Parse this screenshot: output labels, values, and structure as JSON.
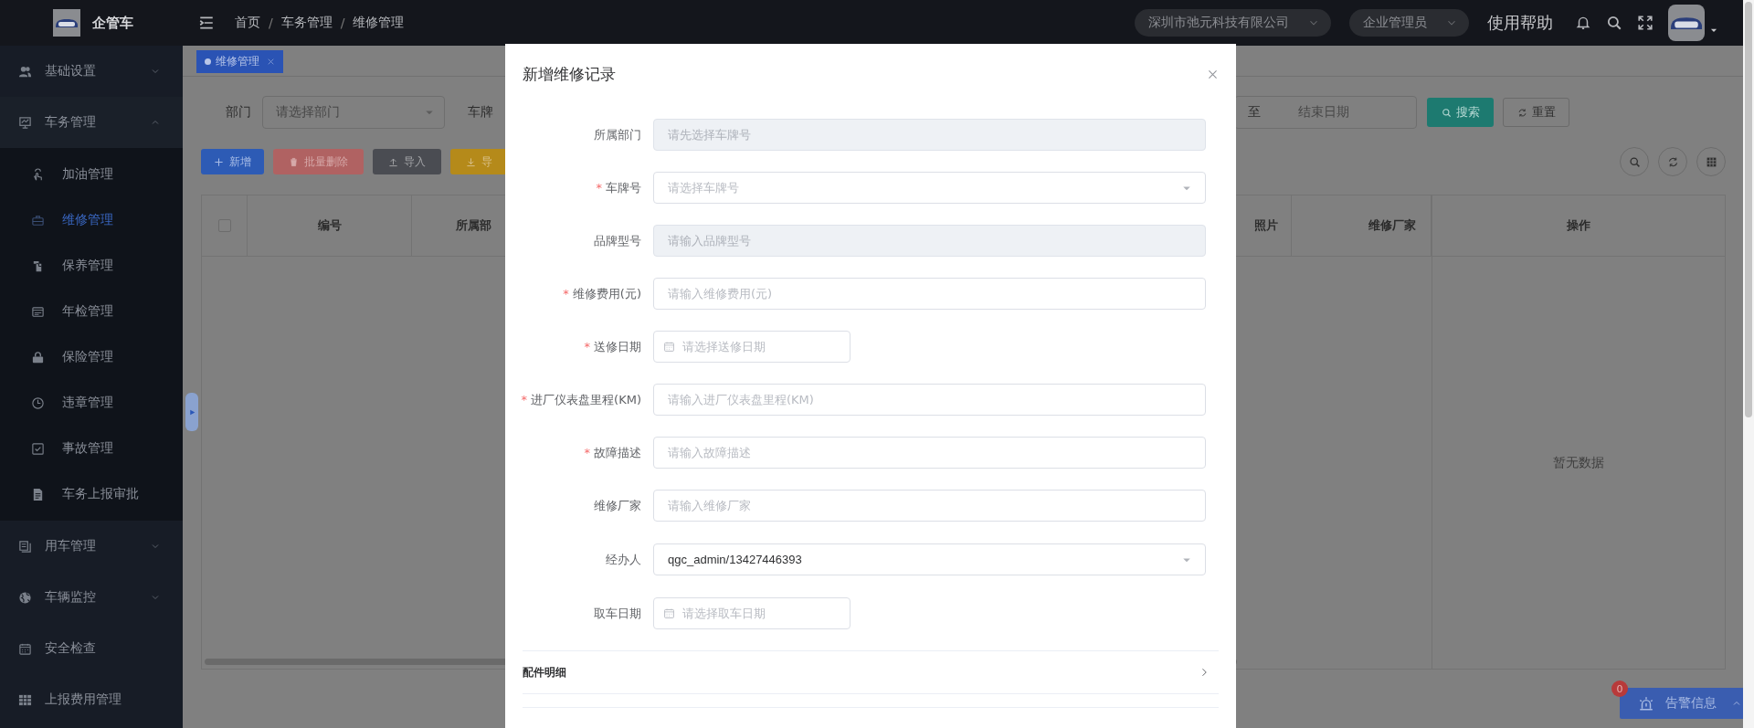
{
  "header": {
    "brand": "企管车",
    "breadcrumb": [
      "首页",
      "车务管理",
      "维修管理"
    ],
    "breadcrumb_separator": "/",
    "company": "深圳市弛元科技有限公司",
    "role": "企业管理员",
    "help": "使用帮助"
  },
  "sidebar": {
    "items": [
      {
        "label": "基础设置",
        "expanded": false
      },
      {
        "label": "车务管理",
        "expanded": true,
        "children": [
          {
            "label": "加油管理",
            "selected": false
          },
          {
            "label": "维修管理",
            "selected": true
          },
          {
            "label": "保养管理",
            "selected": false
          },
          {
            "label": "年检管理",
            "selected": false
          },
          {
            "label": "保险管理",
            "selected": false
          },
          {
            "label": "违章管理",
            "selected": false
          },
          {
            "label": "事故管理",
            "selected": false
          },
          {
            "label": "车务上报审批",
            "selected": false
          }
        ]
      },
      {
        "label": "用车管理",
        "expanded": false
      },
      {
        "label": "车辆监控",
        "expanded": false
      },
      {
        "label": "安全检查"
      },
      {
        "label": "上报费用管理"
      }
    ]
  },
  "tabs": [
    {
      "label": "维修管理",
      "selected": true
    }
  ],
  "filters": [
    {
      "label": "部门",
      "placeholder": "请选择部门"
    },
    {
      "label": "车牌"
    }
  ],
  "date_range": {
    "separator": "至",
    "end_placeholder": "结束日期"
  },
  "filter_buttons": [
    {
      "label": "搜索",
      "kind": "primary"
    },
    {
      "label": "重置",
      "kind": "plain"
    }
  ],
  "toolbar": [
    {
      "label": "新增",
      "kind": "primary"
    },
    {
      "label": "批量删除",
      "kind": "danger"
    },
    {
      "label": "导入",
      "kind": "info"
    },
    {
      "label": "导",
      "kind": "warning"
    }
  ],
  "table": {
    "select_all_checked": false,
    "columns": [
      "编号",
      "所属部",
      "照片",
      "维修厂家",
      "操作"
    ],
    "empty_text": "暂无数据"
  },
  "alert": {
    "label": "告警信息",
    "count": "0"
  },
  "dialog": {
    "title": "新增维修记录",
    "required_mark": "*",
    "fields": [
      {
        "label": "所属部门",
        "placeholder": "请先选择车牌号",
        "kind": "input",
        "required": false,
        "disabled": true
      },
      {
        "label": "车牌号",
        "placeholder": "请选择车牌号",
        "kind": "select",
        "required": true,
        "disabled": false
      },
      {
        "label": "品牌型号",
        "placeholder": "请输入品牌型号",
        "kind": "input",
        "required": false,
        "disabled": true
      },
      {
        "label": "维修费用(元)",
        "placeholder": "请输入维修费用(元)",
        "kind": "input",
        "required": true,
        "disabled": false
      },
      {
        "label": "送修日期",
        "placeholder": "请选择送修日期",
        "kind": "date",
        "required": true,
        "disabled": false
      },
      {
        "label": "进厂仪表盘里程(KM)",
        "placeholder": "请输入进厂仪表盘里程(KM)",
        "kind": "input",
        "required": true,
        "disabled": false
      },
      {
        "label": "故障描述",
        "placeholder": "请输入故障描述",
        "kind": "input",
        "required": true,
        "disabled": false
      },
      {
        "label": "维修厂家",
        "placeholder": "请输入维修厂家",
        "kind": "input",
        "required": false,
        "disabled": false
      },
      {
        "label": "经办人",
        "value": "qgc_admin/13427446393",
        "kind": "select",
        "required": false,
        "disabled": false
      },
      {
        "label": "取车日期",
        "placeholder": "请选择取车日期",
        "kind": "date",
        "required": false,
        "disabled": false
      }
    ],
    "sections": [
      {
        "label": "配件明细",
        "expanded": false
      }
    ]
  }
}
